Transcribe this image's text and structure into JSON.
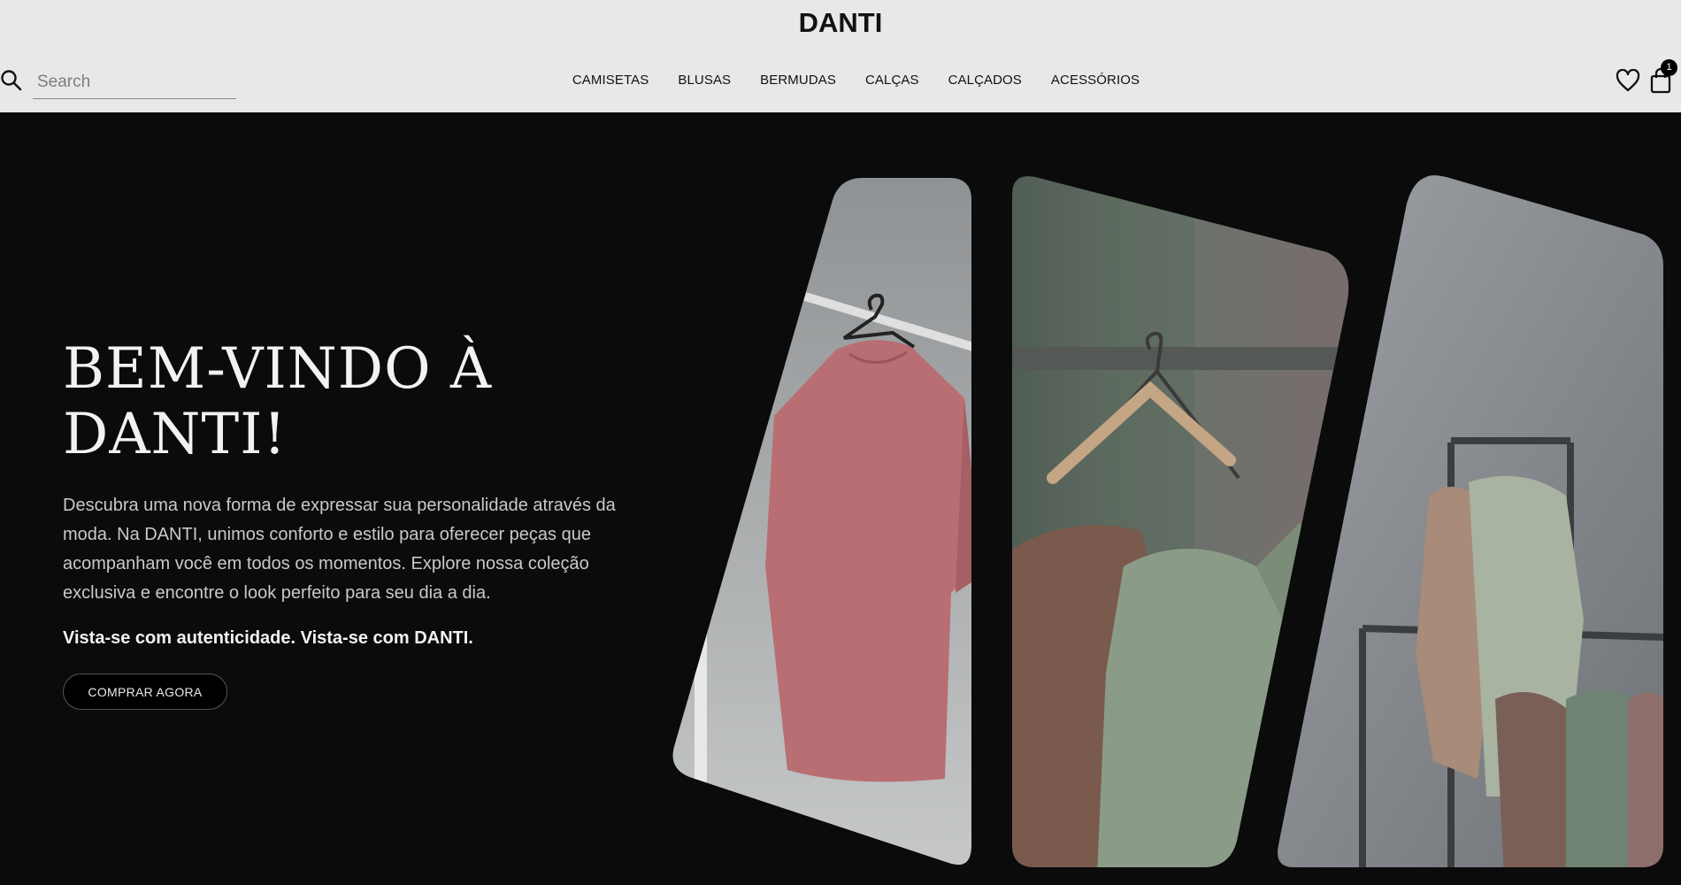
{
  "header": {
    "logo": "DANTI",
    "search_placeholder": "Search",
    "nav": [
      "CAMISETAS",
      "BLUSAS",
      "BERMUDAS",
      "CALÇAS",
      "CALÇADOS",
      "ACESSÓRIOS"
    ],
    "cart_count": "1"
  },
  "hero": {
    "title_line1": "BEM-VINDO À",
    "title_line2": "DANTI!",
    "description": "Descubra uma nova forma de expressar sua personalidade através da moda. Na DANTI, unimos conforto e estilo para oferecer peças que acompanham você em todos os momentos. Explore nossa coleção exclusiva e encontre o look perfeito para seu dia a dia.",
    "tagline": "Vista-se com autenticidade. Vista-se com DANTI.",
    "cta_label": "COMPRAR AGORA"
  },
  "gallery": {
    "images": [
      "pink-tshirt-on-hanger",
      "green-and-brown-shirts-on-rack",
      "hoodies-on-clothing-rack"
    ]
  },
  "colors": {
    "header_bg": "#e8e8e8",
    "hero_bg": "#0b0b0c",
    "text_light": "#f2f2f2",
    "text_muted": "#c9c9c9"
  }
}
